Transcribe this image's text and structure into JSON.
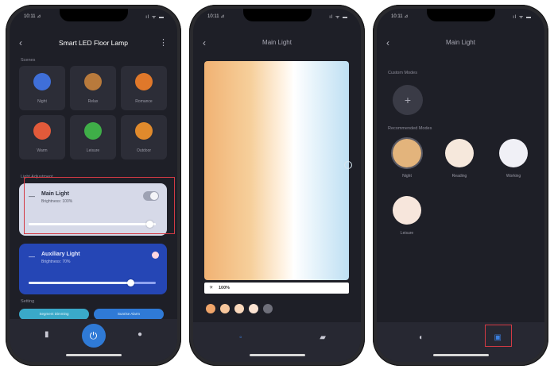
{
  "phone1": {
    "status": {
      "time": "10:11 ⊿",
      "signal": "ıl ᯤ ▬"
    },
    "title": "Smart LED Floor Lamp",
    "scenes_label": "Scenes",
    "scenes": [
      {
        "label": "Night",
        "color": "#3f6fd8"
      },
      {
        "label": "Relax",
        "color": "#b87a3c"
      },
      {
        "label": "Romance",
        "color": "#e0782a"
      },
      {
        "label": "Warm",
        "color": "#e25a3a"
      },
      {
        "label": "Leisure",
        "color": "#3fae48"
      },
      {
        "label": "Outdoor",
        "color": "#e08a2c"
      }
    ],
    "lights_label": "Light Adjustment",
    "main_light": {
      "name": "Main Light",
      "sub": "Brightness: 100%",
      "brightness": 0.95,
      "on": true
    },
    "aux_light": {
      "name": "Auxiliary Light",
      "sub": "Brightness: 70%",
      "brightness": 0.8
    },
    "settings_label": "Setting",
    "pills": [
      "Segment Dimming",
      "Sunrise Alarm"
    ]
  },
  "phone2": {
    "status": {
      "time": "10:11 ⊿",
      "signal": "ıl ᯤ ▬"
    },
    "title": "Main Light",
    "brightness": "100%",
    "swatches": [
      "#f0a56a",
      "#f6c69c",
      "#f9d8bc",
      "#fbe3d2",
      "#6e6f7a"
    ]
  },
  "phone3": {
    "status": {
      "time": "10:11 ⊿",
      "signal": "ıl ᯤ ▬"
    },
    "title": "Main Light",
    "custom_label": "Custom Modes",
    "preset_label": "Recommended Modes",
    "presets": [
      {
        "label": "Night",
        "color": "#e3b47c"
      },
      {
        "label": "Reading",
        "color": "#f6e8dc"
      },
      {
        "label": "Working",
        "color": "#f0f0f6"
      },
      {
        "label": "Leisure",
        "color": "#f7e6dc"
      }
    ]
  }
}
